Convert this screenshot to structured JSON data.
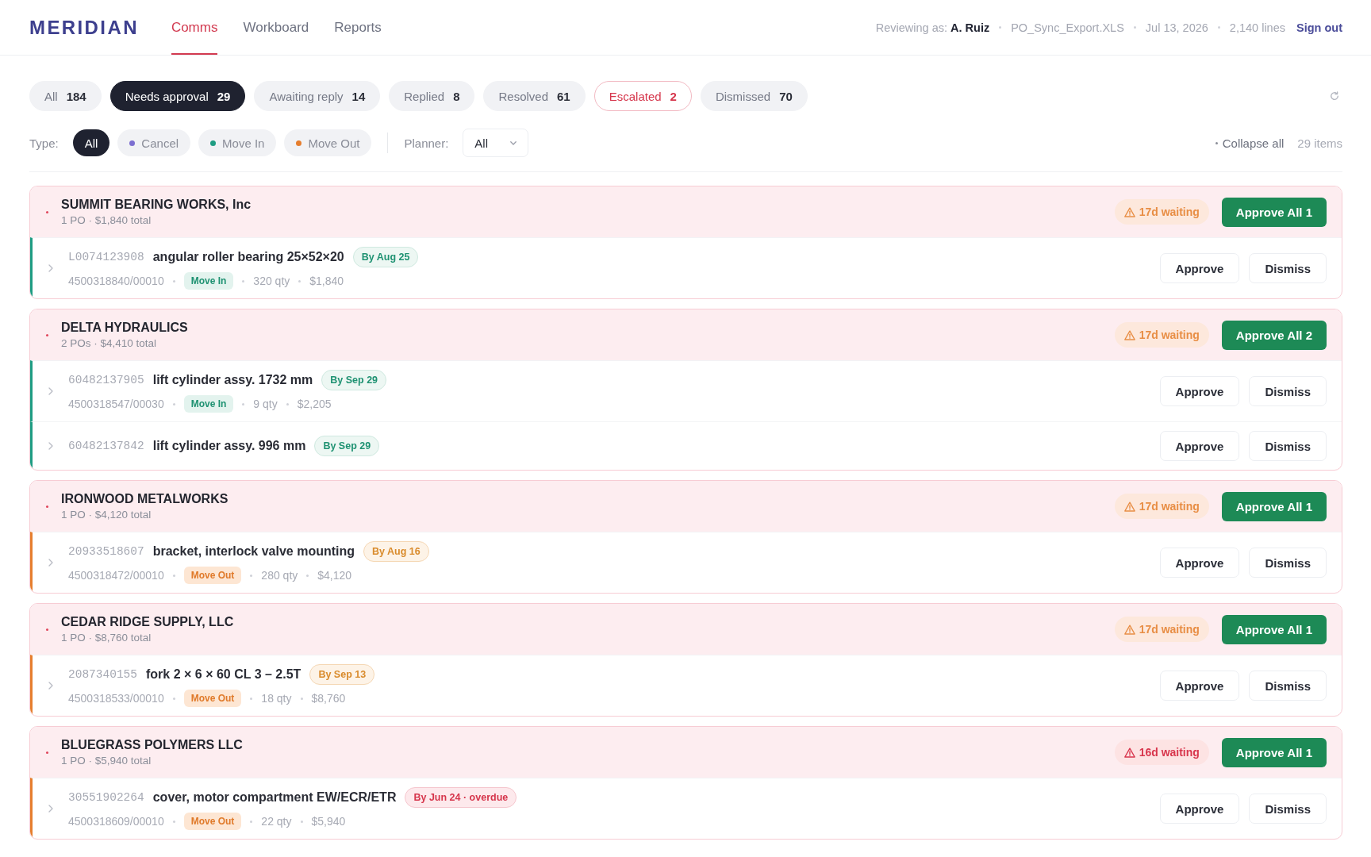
{
  "app": {
    "logo": "MERIDIAN",
    "nav": [
      {
        "label": "Comms",
        "selected": true
      },
      {
        "label": "Workboard",
        "selected": false
      },
      {
        "label": "Reports",
        "selected": false
      }
    ],
    "session": {
      "reviewer": "Reviewing as: **A. Ruiz**",
      "file": "PO_Sync_Export.XLS",
      "date": "Jul 13, 2026",
      "lines": "2,140 lines",
      "sign_out": "Sign out"
    }
  },
  "status_tabs": [
    {
      "label": "All",
      "count": "184",
      "selected": false,
      "kind": "normal"
    },
    {
      "label": "Needs approval",
      "count": "29",
      "selected": true,
      "kind": "normal"
    },
    {
      "label": "Awaiting reply",
      "count": "14",
      "selected": false,
      "kind": "normal"
    },
    {
      "label": "Replied",
      "count": "8",
      "selected": false,
      "kind": "normal"
    },
    {
      "label": "Resolved",
      "count": "61",
      "selected": false,
      "kind": "normal"
    },
    {
      "label": "Escalated",
      "count": "2",
      "selected": false,
      "kind": "alert"
    },
    {
      "label": "Dismissed",
      "count": "70",
      "selected": false,
      "kind": "normal"
    }
  ],
  "filters": {
    "type_label": "Type:",
    "types": [
      {
        "label": "All",
        "selected": true
      },
      {
        "label": "Cancel",
        "selected": false,
        "color": "#7c6fd1"
      },
      {
        "label": "Move In",
        "selected": false,
        "color": "#1f9d83"
      },
      {
        "label": "Move Out",
        "selected": false,
        "color": "#e67e2e"
      }
    ],
    "planner_label": "Planner:",
    "planner_value": "All",
    "collapse_all": "Collapse all",
    "item_count": "29 items"
  },
  "groups": [
    {
      "supplier": "SUMMIT BEARING WORKS, Inc",
      "summary": "1 PO · $1,840 total",
      "waiting": "17d waiting",
      "urgent": false,
      "approve_all": "Approve All 1",
      "items": [
        {
          "part": "L0074123908",
          "name": "angular roller bearing 25×52×20",
          "due": "By Aug 25",
          "overdue": false,
          "kind": "move_in",
          "po": "4500318840/00010",
          "type_label": "Move In",
          "qty": "320 qty",
          "amount": "$1,840",
          "actions": [
            "Approve",
            "Dismiss"
          ]
        }
      ]
    },
    {
      "supplier": "DELTA HYDRAULICS",
      "summary": "2 POs · $4,410 total",
      "waiting": "17d waiting",
      "urgent": false,
      "approve_all": "Approve All 2",
      "items": [
        {
          "part": "60482137905",
          "name": "lift cylinder assy. 1732 mm",
          "due": "By Sep 29",
          "overdue": false,
          "kind": "move_in",
          "po": "4500318547/00030",
          "type_label": "Move In",
          "qty": "9 qty",
          "amount": "$2,205",
          "actions": [
            "Approve",
            "Dismiss"
          ]
        },
        {
          "part": "60482137842",
          "name": "lift cylinder assy. 996 mm",
          "due": "By Sep 29",
          "overdue": false,
          "kind": "move_in",
          "actions": [
            "Approve",
            "Dismiss"
          ]
        }
      ]
    },
    {
      "supplier": "IRONWOOD METALWORKS",
      "summary": "1 PO · $4,120 total",
      "waiting": "17d waiting",
      "urgent": false,
      "approve_all": "Approve All 1",
      "items": [
        {
          "part": "20933518607",
          "name": "bracket, interlock valve mounting",
          "due": "By Aug 16",
          "overdue": false,
          "kind": "move_out",
          "po": "4500318472/00010",
          "type_label": "Move Out",
          "qty": "280 qty",
          "amount": "$4,120",
          "actions": [
            "Approve",
            "Dismiss"
          ]
        }
      ]
    },
    {
      "supplier": "CEDAR RIDGE SUPPLY, LLC",
      "summary": "1 PO · $8,760 total",
      "waiting": "17d waiting",
      "urgent": false,
      "approve_all": "Approve All 1",
      "items": [
        {
          "part": "2087340155",
          "name": "fork 2 × 6 × 60 CL 3 – 2.5T",
          "due": "By Sep 13",
          "overdue": false,
          "kind": "move_out",
          "po": "4500318533/00010",
          "type_label": "Move Out",
          "qty": "18 qty",
          "amount": "$8,760",
          "actions": [
            "Approve",
            "Dismiss"
          ]
        }
      ]
    },
    {
      "supplier": "BLUEGRASS POLYMERS LLC",
      "summary": "1 PO · $5,940 total",
      "waiting": "16d waiting",
      "urgent": true,
      "approve_all": "Approve All 1",
      "items": [
        {
          "part": "30551902264",
          "name": "cover, motor compartment EW/ECR/ETR",
          "due": "By Jun 24 · overdue",
          "overdue": true,
          "kind": "move_out",
          "po": "4500318609/00010",
          "type_label": "Move Out",
          "qty": "22 qty",
          "amount": "$5,940",
          "actions": [
            "Approve",
            "Dismiss"
          ]
        }
      ]
    }
  ]
}
